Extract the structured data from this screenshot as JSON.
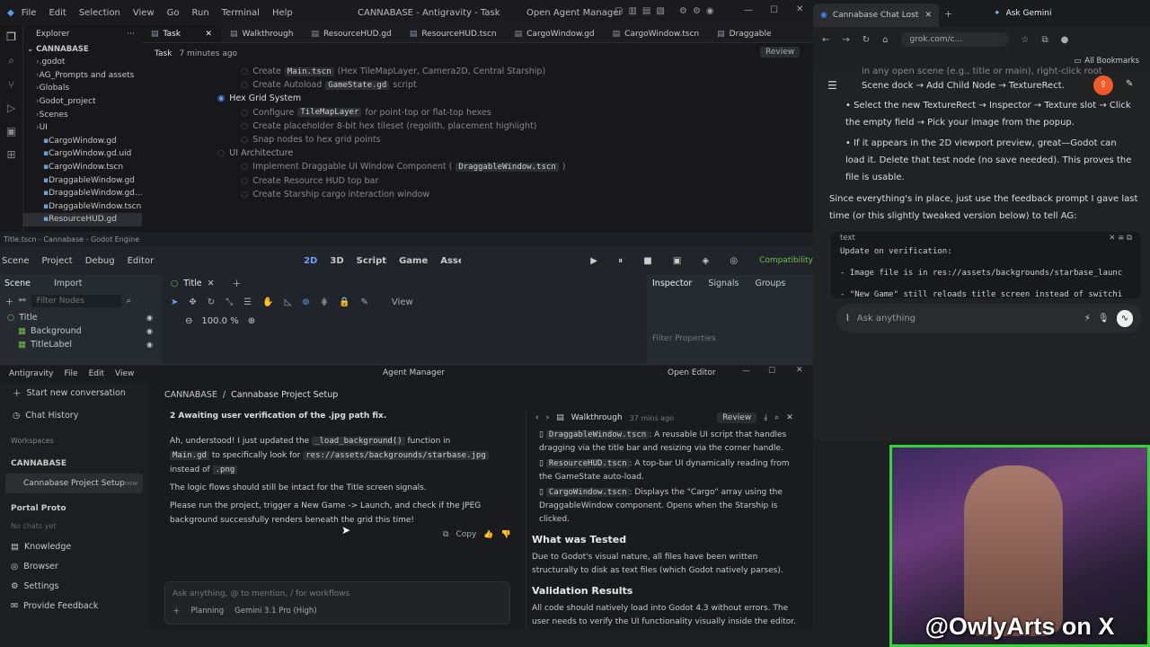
{
  "antigravity": {
    "menu": [
      "File",
      "Edit",
      "Selection",
      "View",
      "Go",
      "Run",
      "Terminal",
      "Help"
    ],
    "window_title": "CANNABASE - Antigravity - Task",
    "open_agent_manager": "Open Agent Manager",
    "explorer": {
      "title": "Explorer",
      "root": "CANNABASE",
      "items": [
        ".godot",
        "AG_Prompts and assets",
        "Globals",
        "Godot_project",
        "Scenes",
        "UI",
        "CargoWindow.gd",
        "CargoWindow.gd.uid",
        "CargoWindow.tscn",
        "DraggableWindow.gd",
        "DraggableWindow.gd....",
        "DraggableWindow.tscn",
        "ResourceHUD.gd"
      ]
    },
    "tabs": [
      "Task",
      "Walkthrough",
      "ResourceHUD.gd",
      "ResourceHUD.tscn",
      "CargoWindow.gd",
      "CargoWindow.tscn",
      "Draggable"
    ],
    "task_crumb": "Task",
    "task_time": "7 minutes ago",
    "review_btn": "Review",
    "task_lines": [
      {
        "text": "Create",
        "code": "Main.tscn",
        "rest": "(Hex TileMapLayer, Camera2D, Central Starship)"
      },
      {
        "text": "Create Autoload",
        "code": "GameState.gd",
        "rest": "script"
      },
      {
        "text": "Hex Grid System",
        "code": "",
        "rest": ""
      },
      {
        "text": "Configure",
        "code": "TileMapLayer",
        "rest": "for point-top or flat-top hexes"
      },
      {
        "text": "Create placeholder 8-bit hex tileset (regolith, placement highlight)",
        "code": "",
        "rest": ""
      },
      {
        "text": "Snap nodes to hex grid points",
        "code": "",
        "rest": ""
      },
      {
        "text": "UI Architecture",
        "code": "",
        "rest": ""
      },
      {
        "text": "Implement Draggable UI Window Component (",
        "code": "DraggableWindow.tscn",
        "rest": ")"
      },
      {
        "text": "Create Resource HUD top bar",
        "code": "",
        "rest": ""
      },
      {
        "text": "Create Starship cargo interaction window",
        "code": "",
        "rest": ""
      }
    ]
  },
  "godot": {
    "title": "Title.tscn - Cannabase - Godot Engine",
    "menu": [
      "Scene",
      "Project",
      "Debug",
      "Editor",
      "Help"
    ],
    "modes": [
      "2D",
      "3D",
      "Script",
      "Game",
      "AssetLib"
    ],
    "compat": "Compatibility",
    "scene_tab": "Scene",
    "import_tab": "Import",
    "filter_nodes": "Filter Nodes",
    "nodes": [
      "Title",
      "Background",
      "TitleLabel"
    ],
    "doc_tab": "Title",
    "view_label": "View",
    "zoom": "100.0 %",
    "inspector": "Inspector",
    "signals": "Signals",
    "groups": "Groups",
    "filter_props": "Filter Properties"
  },
  "agent_manager": {
    "menu": [
      "Antigravity",
      "File",
      "Edit",
      "View"
    ],
    "title": "Agent Manager",
    "open_editor": "Open Editor",
    "side": {
      "new_conv": "Start new conversation",
      "chat_history": "Chat History",
      "workspaces": "Workspaces",
      "workspace": "CANNABASE",
      "project": "Cannabase Project Setup",
      "project_time": "now",
      "portal": "Portal Proto",
      "no_chats": "No chats yet",
      "knowledge": "Knowledge",
      "browser": "Browser",
      "settings": "Settings",
      "feedback": "Provide Feedback"
    },
    "breadcrumb_a": "CANNABASE",
    "breadcrumb_b": "Cannabase Project Setup",
    "step": "2  Awaiting user verification of the .jpg path fix.",
    "msg1_a": "Ah, understood! I just updated the",
    "msg1_code1": "_load_background()",
    "msg1_b": "function in",
    "msg1_code2": "Main.gd",
    "msg1_c": "to specifically look for",
    "msg1_code3": "res://assets/backgrounds/starbase.jpg",
    "msg1_d": "instead of",
    "msg1_code4": ".png",
    "msg2": "The logic flows should still be intact for the Title screen signals.",
    "msg3": "Please run the project, trigger a New Game -> Launch, and check if the JPEG background successfully renders beneath the grid this time!",
    "copy": "Copy",
    "input_placeholder": "Ask anything, @ to mention, / for workflows",
    "planning": "Planning",
    "model": "Gemini 3.1 Pro (High)",
    "walk": {
      "title": "Walkthrough",
      "time": "37 mins ago",
      "review": "Review",
      "items": [
        {
          "code": "DraggableWindow.tscn",
          "text": ": A reusable UI script that handles dragging via the title bar and resizing via the corner handle."
        },
        {
          "code": "ResourceHUD.tscn",
          "text": ": A top-bar UI dynamically reading from the GameState auto-load."
        },
        {
          "code": "CargoWindow.tscn",
          "text": ": Displays the \"Cargo\" array using the DraggableWindow component. Opens when the Starship is clicked."
        }
      ],
      "h1": "What was Tested",
      "p1": "Due to Godot's visual nature, all files have been written structurally to disk as text files (which Godot natively parses).",
      "h2": "Validation Results",
      "p2": "All code should natively load into Godot 4.3 without errors. The user needs to verify the UI functionality visually inside the editor."
    }
  },
  "chrome": {
    "tab1": "Cannabase Chat Lost: Re",
    "tab2": "Ask Gemini",
    "url": "grok.com/c...",
    "bookmarks": "All Bookmarks",
    "top_line": "in any open scene (e.g., title or main), right-click root",
    "top_line2": "Scene dock → Add Child Node → TextureRect.",
    "b1": "Select the new TextureRect → Inspector → Texture slot → Click the empty field → Pick your image from the popup.",
    "b2": "If it appears in the 2D viewport preview, great—Godot can load it. Delete that test node (no save needed). This proves the file is usable.",
    "para": "Since everything's in place, just use the feedback prompt I gave last time (or this slightly tweaked version below) to tell AG:",
    "code_label": "text",
    "code_lines": [
      "Update on verification:",
      "",
      "- Image file is in res://assets/backgrounds/starbase_launc",
      "",
      "- \"New Game\" still reloads title screen instead of switchi",
      "- Background remains default/gray in Starbase scene—no Tex",
      "",
      "Please re-apply/fix:",
      "- Confirm or regenerate TextureRect in main scene with",
      "- Force anchors full rect, stretch mode Scale, mouse ignor"
    ],
    "ask": "Ask anything"
  },
  "webcam": {
    "watermark": "@OwlyArts on X"
  }
}
